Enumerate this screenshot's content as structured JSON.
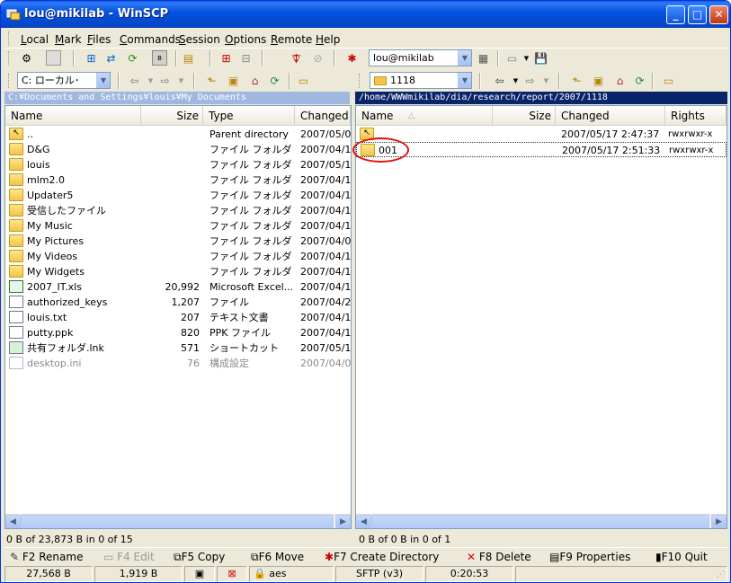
{
  "window": {
    "title": "lou@mikilab - WinSCP"
  },
  "menu": [
    {
      "label": "Local",
      "u": "L",
      "rest": "ocal"
    },
    {
      "label": "Mark",
      "u": "M",
      "rest": "ark"
    },
    {
      "label": "Files",
      "u": "F",
      "rest": "iles"
    },
    {
      "label": "Commands",
      "u": "C",
      "rest": "ommands"
    },
    {
      "label": "Session",
      "u": "S",
      "rest": "ession"
    },
    {
      "label": "Options",
      "u": "O",
      "rest": "ptions"
    },
    {
      "label": "Remote",
      "u": "R",
      "rest": "emote"
    },
    {
      "label": "Help",
      "u": "H",
      "rest": "elp"
    }
  ],
  "toolbar": {
    "session_combo": "lou@mikilab"
  },
  "left": {
    "drive_combo": "C: ローカル･",
    "path": "C:¥Documents and Settings¥louis¥My Documents",
    "columns": [
      "Name",
      "Size",
      "Type",
      "Changed"
    ],
    "rows": [
      {
        "name": "..",
        "size": "",
        "type": "Parent directory",
        "changed": "2007/05/0",
        "icon": "parent"
      },
      {
        "name": "D&G",
        "size": "",
        "type": "ファイル フォルダ",
        "changed": "2007/04/1",
        "icon": "folder"
      },
      {
        "name": "louis",
        "size": "",
        "type": "ファイル フォルダ",
        "changed": "2007/05/1",
        "icon": "folder"
      },
      {
        "name": "mlm2.0",
        "size": "",
        "type": "ファイル フォルダ",
        "changed": "2007/04/1",
        "icon": "folder"
      },
      {
        "name": "Updater5",
        "size": "",
        "type": "ファイル フォルダ",
        "changed": "2007/04/1",
        "icon": "folder"
      },
      {
        "name": "受信したファイル",
        "size": "",
        "type": "ファイル フォルダ",
        "changed": "2007/04/1",
        "icon": "folder"
      },
      {
        "name": "My Music",
        "size": "",
        "type": "ファイル フォルダ",
        "changed": "2007/04/1",
        "icon": "music"
      },
      {
        "name": "My Pictures",
        "size": "",
        "type": "ファイル フォルダ",
        "changed": "2007/04/0",
        "icon": "pictures"
      },
      {
        "name": "My Videos",
        "size": "",
        "type": "ファイル フォルダ",
        "changed": "2007/04/1",
        "icon": "videos"
      },
      {
        "name": "My Widgets",
        "size": "",
        "type": "ファイル フォルダ",
        "changed": "2007/04/1",
        "icon": "widgets"
      },
      {
        "name": "2007_IT.xls",
        "size": "20,992",
        "type": "Microsoft Excel...",
        "changed": "2007/04/1",
        "icon": "excel"
      },
      {
        "name": "authorized_keys",
        "size": "1,207",
        "type": "ファイル",
        "changed": "2007/04/2",
        "icon": "file"
      },
      {
        "name": "louis.txt",
        "size": "207",
        "type": "テキスト文書",
        "changed": "2007/04/1",
        "icon": "text"
      },
      {
        "name": "putty.ppk",
        "size": "820",
        "type": "PPK ファイル",
        "changed": "2007/04/1",
        "icon": "file"
      },
      {
        "name": "共有フォルダ.lnk",
        "size": "571",
        "type": "ショートカット",
        "changed": "2007/05/1",
        "icon": "shortcut"
      },
      {
        "name": "desktop.ini",
        "size": "76",
        "type": "構成設定",
        "changed": "2007/04/0",
        "icon": "ini",
        "dim": true
      }
    ],
    "status": "0 B of 23,873 B in 0 of 15"
  },
  "right": {
    "dir_combo": "1118",
    "path": "/home/WWWmikilab/dia/research/report/2007/1118",
    "columns": [
      "Name",
      "Size",
      "Changed",
      "Rights"
    ],
    "rows": [
      {
        "name": "",
        "size": "",
        "changed": "2007/05/17 2:47:37",
        "rights": "rwxrwxr-x",
        "icon": "parent"
      },
      {
        "name": "001",
        "size": "",
        "changed": "2007/05/17 2:51:33",
        "rights": "rwxrwxr-x",
        "icon": "folder",
        "selected": true
      }
    ],
    "status": "0 B of 0 B in 0 of 1"
  },
  "fkeys": [
    {
      "label": "F2 Rename",
      "icon": "rename-icon",
      "disabled": false
    },
    {
      "label": "F4 Edit",
      "icon": "edit-icon",
      "disabled": true
    },
    {
      "label": "F5 Copy",
      "icon": "copy-icon",
      "disabled": false
    },
    {
      "label": "F6 Move",
      "icon": "move-icon",
      "disabled": false
    },
    {
      "label": "F7 Create Directory",
      "icon": "create-directory-icon",
      "disabled": false
    },
    {
      "label": "F8 Delete",
      "icon": "delete-icon",
      "disabled": false
    },
    {
      "label": "F9 Properties",
      "icon": "properties-icon",
      "disabled": false
    },
    {
      "label": "F10 Quit",
      "icon": "quit-icon",
      "disabled": false
    }
  ],
  "statusbar": {
    "bytes_received": "27,568 B",
    "bytes_sent": "1,919 B",
    "cipher": "aes",
    "protocol": "SFTP (v3)",
    "duration": "0:20:53"
  }
}
